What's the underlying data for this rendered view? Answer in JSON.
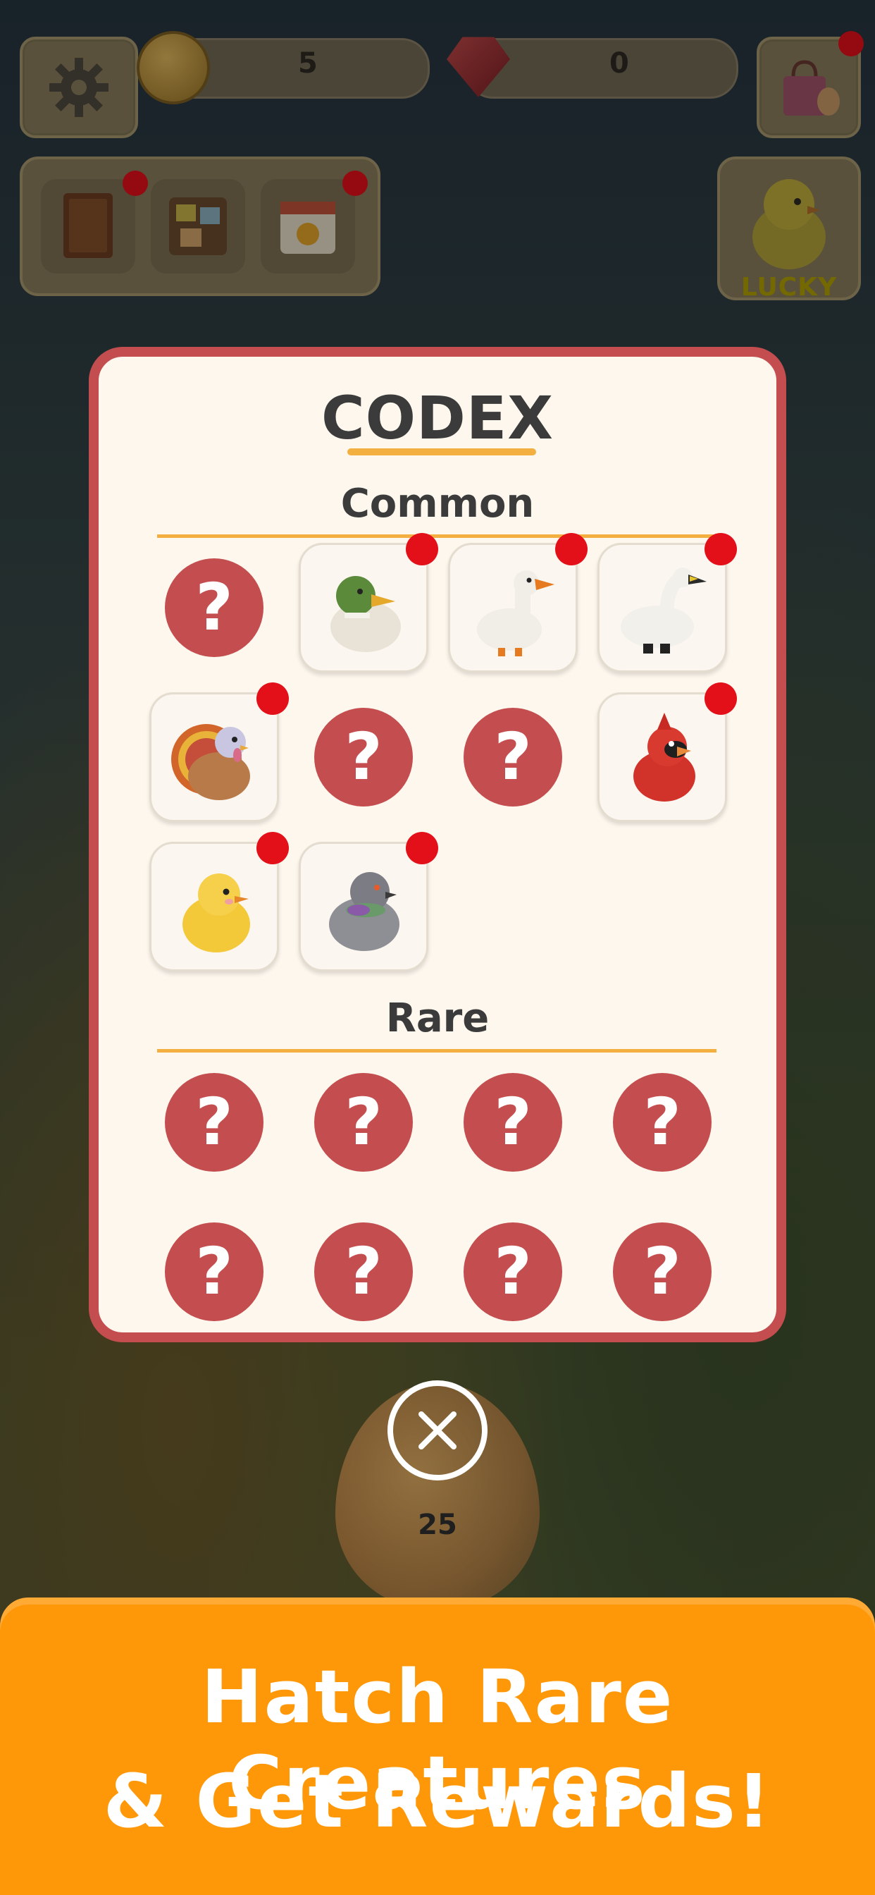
{
  "hud": {
    "dna_count": "5",
    "gem_count": "0",
    "lucky_label": "LUCKY"
  },
  "modal": {
    "title": "CODEX",
    "sections": [
      {
        "name": "Common"
      },
      {
        "name": "Rare"
      }
    ],
    "unknown_mark": "?"
  },
  "egg": {
    "count": "25"
  },
  "banner": {
    "line1": "Hatch Rare Creatures",
    "line2": "& Get Rewards!"
  },
  "colors": {
    "modal_border": "#c44e4f",
    "accent_orange": "#ff9809",
    "underline": "#f3b041",
    "notification_dot": "#e3101a"
  }
}
